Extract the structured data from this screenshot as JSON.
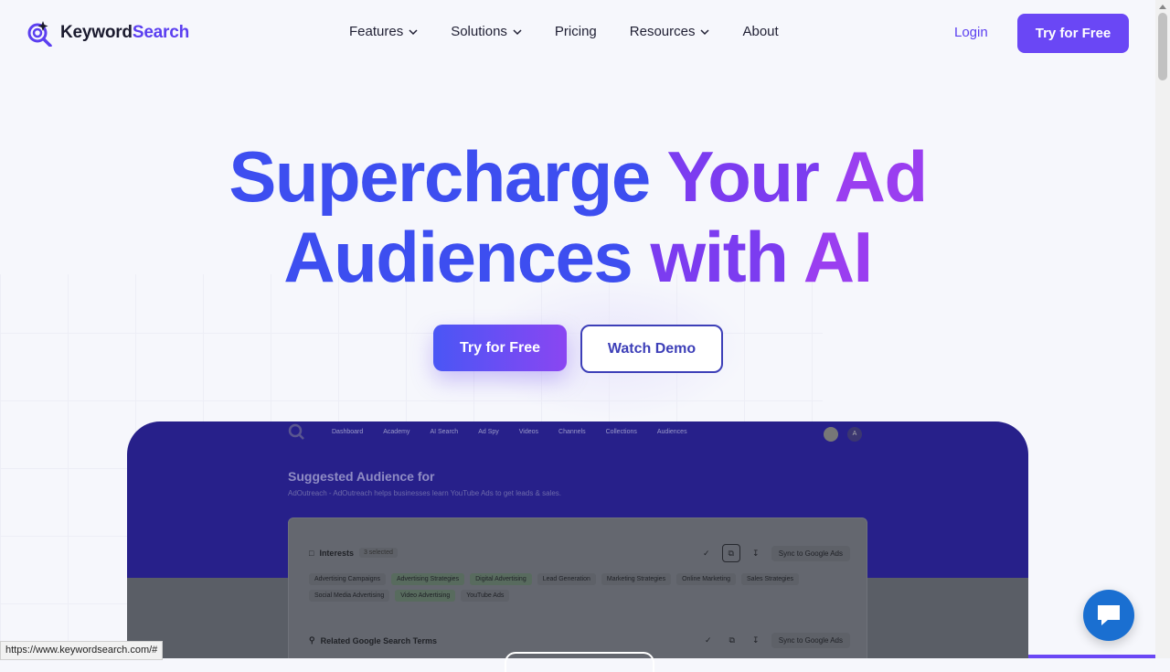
{
  "brand": {
    "name_part1": "Keyword",
    "name_part2": "Search"
  },
  "nav": {
    "items": [
      {
        "label": "Features",
        "dropdown": true
      },
      {
        "label": "Solutions",
        "dropdown": true
      },
      {
        "label": "Pricing",
        "dropdown": false
      },
      {
        "label": "Resources",
        "dropdown": true
      },
      {
        "label": "About",
        "dropdown": false
      }
    ],
    "login": "Login",
    "try_free": "Try for Free"
  },
  "hero": {
    "line1_a": "Supercharge",
    "line1_b": "Your",
    "line1_c": "Ad",
    "line2_a": "Audiences",
    "line2_b": "with",
    "line2_c": "AI",
    "cta_primary": "Try for Free",
    "cta_secondary": "Watch Demo"
  },
  "app_preview": {
    "nav": [
      "Dashboard",
      "Academy",
      "AI Search",
      "Ad Spy",
      "Videos",
      "Channels",
      "Collections",
      "Audiences"
    ],
    "avatar_letter": "A",
    "title": "Suggested Audience for",
    "subtitle": "AdOutreach - AdOutreach helps businesses learn YouTube Ads to get leads & sales.",
    "interests_label": "Interests",
    "selected_badge": "3 selected",
    "sync_label": "Sync to Google Ads",
    "chips": [
      {
        "label": "Advertising Campaigns",
        "selected": false
      },
      {
        "label": "Advertising Strategies",
        "selected": true
      },
      {
        "label": "Digital Advertising",
        "selected": true
      },
      {
        "label": "Lead Generation",
        "selected": false
      },
      {
        "label": "Marketing Strategies",
        "selected": false
      },
      {
        "label": "Online Marketing",
        "selected": false
      },
      {
        "label": "Sales Strategies",
        "selected": false
      },
      {
        "label": "Social Media Advertising",
        "selected": false
      },
      {
        "label": "Video Advertising",
        "selected": true
      },
      {
        "label": "YouTube Ads",
        "selected": false
      }
    ],
    "related_label": "Related Google Search Terms",
    "sync_label2": "Sync to Google Ads"
  },
  "status_bar_url": "https://www.keywordsearch.com/#",
  "colors": {
    "accent": "#6a47f5",
    "hero_blue": "#3d4ef0",
    "hero_purple": "#7c3cf0",
    "preview_bg": "#27208a",
    "chat": "#1a6fd1"
  }
}
